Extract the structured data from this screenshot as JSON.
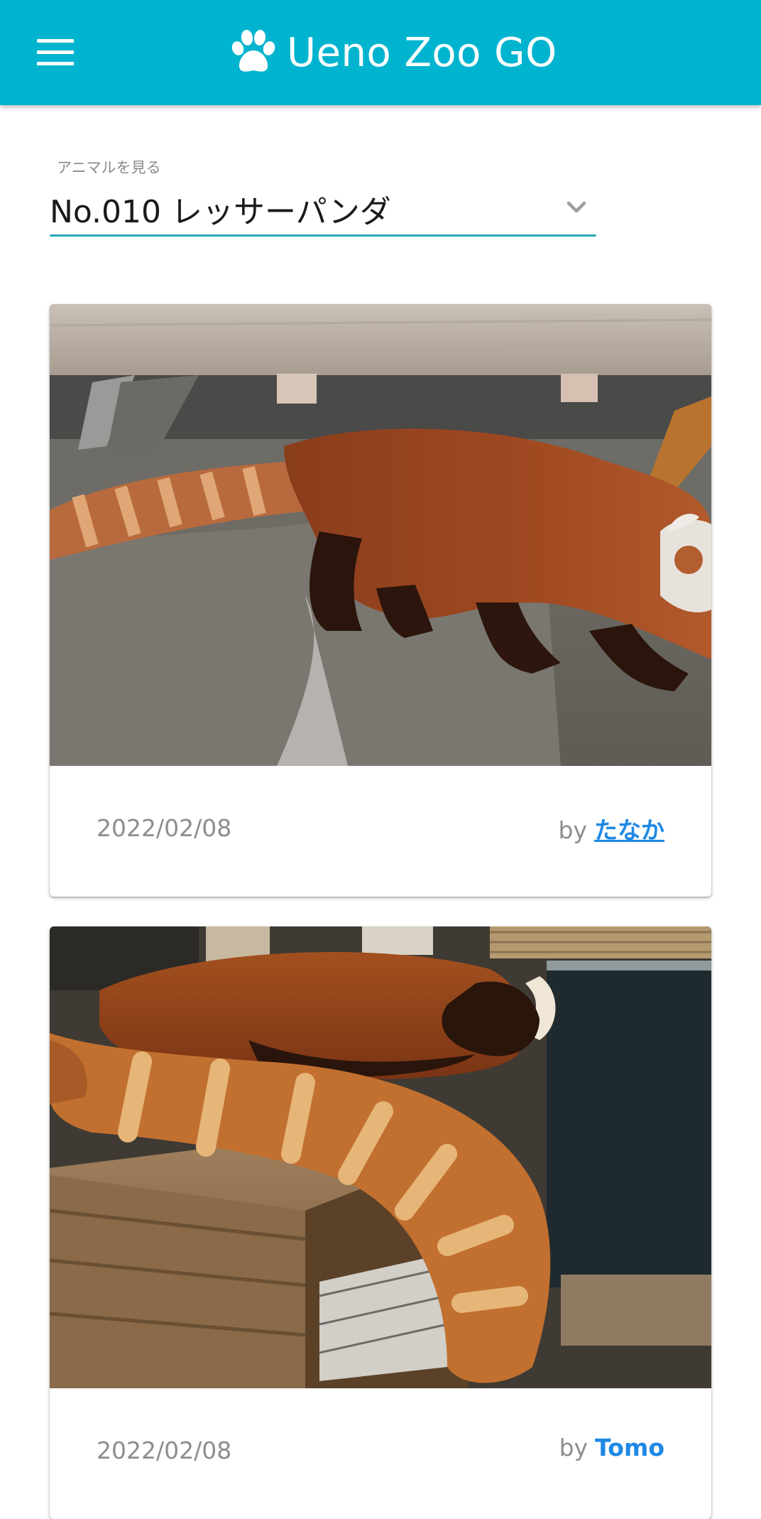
{
  "app_bar": {
    "title": "Ueno Zoo GO",
    "menu_icon": "hamburger-menu-icon",
    "logo_icon": "paw-icon",
    "color": "#00b4cf"
  },
  "animal_select": {
    "label": "アニマルを見る",
    "value": "No.010 レッサーパンダ",
    "underline_color": "#26a9b8"
  },
  "posts": [
    {
      "date": "2022/02/08",
      "by": "by",
      "author": "たなか",
      "photo": "red panda walking on a rock"
    },
    {
      "date": "2022/02/08",
      "by": "by",
      "author": "Tomo",
      "photo": "red panda lying on a wooden box with tail hanging"
    }
  ],
  "colors": {
    "link": "#1e88e5",
    "muted": "#8d8d8d"
  }
}
